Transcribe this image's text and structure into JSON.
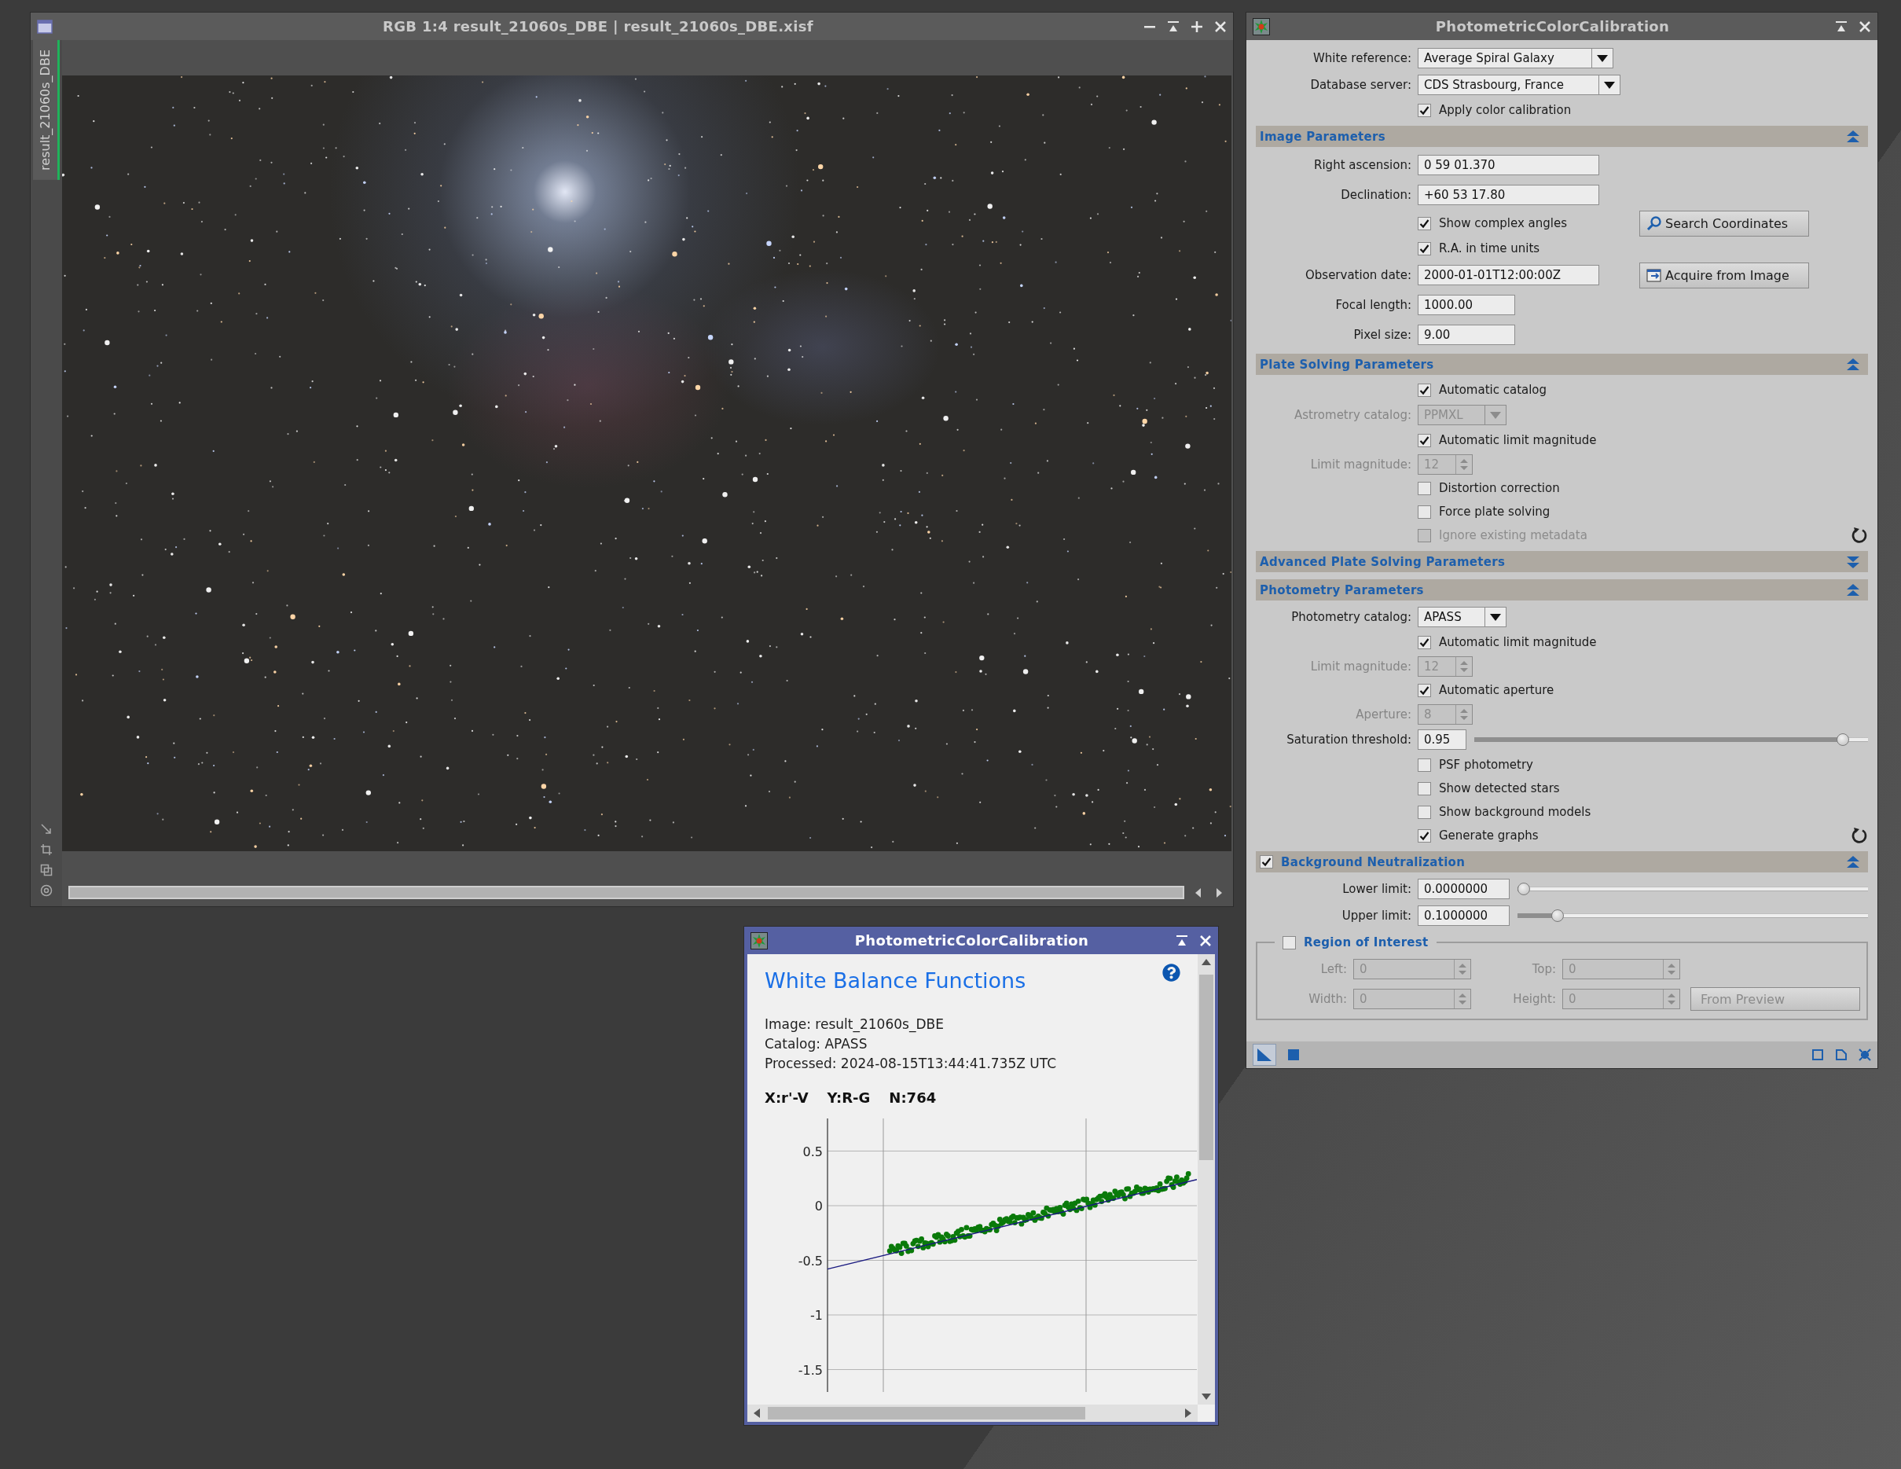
{
  "image_window": {
    "title": "RGB 1:4 result_21060s_DBE | result_21060s_DBE.xisf",
    "side_tab": "result_21060s_DBE"
  },
  "process_window": {
    "title": "PhotometricColorCalibration",
    "rows": [
      {
        "kind": "combo",
        "label": "White reference:",
        "value": "Average Spiral Galaxy",
        "disabled": false
      },
      {
        "kind": "combo",
        "label": "Database server:",
        "value": "CDS Strasbourg, France",
        "disabled": false
      },
      {
        "kind": "check",
        "label": "Apply color calibration",
        "checked": true,
        "disabled": false
      }
    ],
    "sections": [
      {
        "kind": "plain",
        "title": "Image Parameters",
        "expanded": true,
        "reset": false,
        "rows": [
          {
            "kind": "text",
            "label": "Right ascension:",
            "value": "0 59 01.370",
            "disabled": false
          },
          {
            "kind": "text",
            "label": "Declination:",
            "value": "+60 53 17.80",
            "disabled": false
          },
          {
            "kind": "check",
            "label": "Show complex angles",
            "checked": true,
            "disabled": false,
            "button": "Search Coordinates"
          },
          {
            "kind": "check",
            "label": "R.A. in time units",
            "checked": true,
            "disabled": false
          },
          {
            "kind": "text",
            "label": "Observation date:",
            "value": "2000-01-01T12:00:00Z",
            "disabled": false,
            "button": "Acquire from Image"
          },
          {
            "kind": "number",
            "label": "Focal length:",
            "value": "1000.00",
            "disabled": false
          },
          {
            "kind": "number",
            "label": "Pixel size:",
            "value": "9.00",
            "disabled": false
          }
        ]
      },
      {
        "kind": "plain",
        "title": "Plate Solving Parameters",
        "expanded": true,
        "reset": true,
        "rows": [
          {
            "kind": "check",
            "label": "Automatic catalog",
            "checked": true,
            "disabled": false
          },
          {
            "kind": "combo",
            "label": "Astrometry catalog:",
            "value": "PPMXL",
            "disabled": true
          },
          {
            "kind": "check",
            "label": "Automatic limit magnitude",
            "checked": true,
            "disabled": false
          },
          {
            "kind": "spin",
            "label": "Limit magnitude:",
            "value": "12",
            "disabled": true
          },
          {
            "kind": "check",
            "label": "Distortion correction",
            "checked": false,
            "disabled": false
          },
          {
            "kind": "check",
            "label": "Force plate solving",
            "checked": false,
            "disabled": false
          },
          {
            "kind": "check",
            "label": "Ignore existing metadata",
            "checked": false,
            "disabled": true
          }
        ]
      },
      {
        "kind": "plain",
        "title": "Advanced Plate Solving Parameters",
        "expanded": false
      },
      {
        "kind": "plain",
        "title": "Photometry Parameters",
        "expanded": true,
        "reset": true,
        "rows": [
          {
            "kind": "combo",
            "label": "Photometry catalog:",
            "value": "APASS",
            "disabled": false
          },
          {
            "kind": "check",
            "label": "Automatic limit magnitude",
            "checked": true,
            "disabled": false
          },
          {
            "kind": "spin",
            "label": "Limit magnitude:",
            "value": "12",
            "disabled": true
          },
          {
            "kind": "check",
            "label": "Automatic aperture",
            "checked": true,
            "disabled": false
          },
          {
            "kind": "spin",
            "label": "Aperture:",
            "value": "8",
            "disabled": true
          },
          {
            "kind": "slider",
            "label": "Saturation threshold:",
            "value": "0.95",
            "level": 0.95,
            "disabled": false
          },
          {
            "kind": "check",
            "label": "PSF photometry",
            "checked": false,
            "disabled": false
          },
          {
            "kind": "check",
            "label": "Show detected stars",
            "checked": false,
            "disabled": false
          },
          {
            "kind": "check",
            "label": "Show background models",
            "checked": false,
            "disabled": false
          },
          {
            "kind": "check",
            "label": "Generate graphs",
            "checked": true,
            "disabled": false
          }
        ]
      },
      {
        "kind": "checkable",
        "title": "Background Neutralization",
        "checked": true,
        "expanded": true,
        "reset": false,
        "rows": [
          {
            "kind": "slider",
            "label": "Lower limit:",
            "value": "0.0000000",
            "level": 0,
            "disabled": false
          },
          {
            "kind": "slider",
            "label": "Upper limit:",
            "value": "0.1000000",
            "level": 0.1,
            "disabled": false
          },
          {
            "kind": "group",
            "title": "Region of Interest",
            "checked": false,
            "disabled": true,
            "fields": [
              {
                "label": "Left:",
                "value": "0"
              },
              {
                "label": "Top:",
                "value": "0"
              },
              {
                "label": "Width:",
                "value": "0"
              },
              {
                "label": "Height:",
                "value": "0"
              }
            ],
            "button": "From Preview"
          }
        ]
      }
    ]
  },
  "graph_window": {
    "title": "PhotometricColorCalibration",
    "heading": "White Balance Functions",
    "info": [
      "Image: result_21060s_DBE",
      "Catalog: APASS",
      "Processed: 2024-08-15T13:44:41.735Z UTC"
    ],
    "axes": [
      "X:r'-V",
      "Y:R-G",
      "N:764"
    ],
    "y_tick_labels": [
      "0.5",
      "0",
      "-0.5",
      "-1",
      "-1.5"
    ]
  }
}
